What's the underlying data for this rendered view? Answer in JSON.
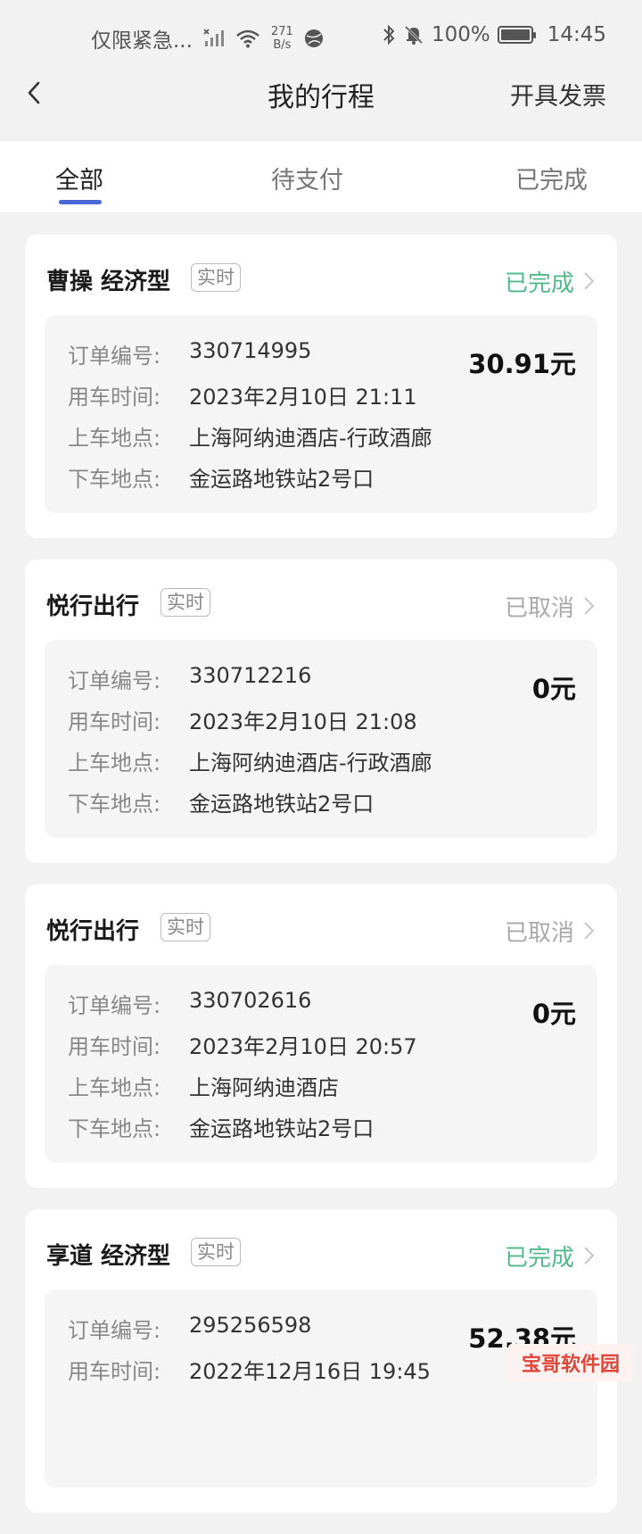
{
  "status_bar": {
    "carrier": "仅限紧急...",
    "net_speed_value": "271",
    "net_speed_unit": "B/s",
    "battery": "100%",
    "time": "14:45",
    "icons": [
      "signal-off-icon",
      "wifi-icon",
      "ball-icon",
      "bluetooth-icon",
      "mute-icon",
      "battery-icon"
    ]
  },
  "header": {
    "title": "我的行程",
    "action": "开具发票"
  },
  "tabs": [
    {
      "label": "全部",
      "active": true
    },
    {
      "label": "待支付",
      "active": false
    },
    {
      "label": "已完成",
      "active": false
    }
  ],
  "labels": {
    "order_no": "订单编号:",
    "time": "用车时间:",
    "pickup": "上车地点:",
    "dropoff": "下车地点:"
  },
  "trips": [
    {
      "provider": "曹操 经济型",
      "tag": "实时",
      "status": "已完成",
      "order_no": "330714995",
      "time": "2023年2月10日 21:11",
      "pickup": "上海阿纳迪酒店-行政酒廊",
      "dropoff": "金运路地铁站2号口",
      "price": "30.91元"
    },
    {
      "provider": "悦行出行",
      "tag": "实时",
      "status": "已取消",
      "order_no": "330712216",
      "time": "2023年2月10日 21:08",
      "pickup": "上海阿纳迪酒店-行政酒廊",
      "dropoff": "金运路地铁站2号口",
      "price": "0元"
    },
    {
      "provider": "悦行出行",
      "tag": "实时",
      "status": "已取消",
      "order_no": "330702616",
      "time": "2023年2月10日 20:57",
      "pickup": "上海阿纳迪酒店",
      "dropoff": "金运路地铁站2号口",
      "price": "0元"
    },
    {
      "provider": "享道 经济型",
      "tag": "实时",
      "status": "已完成",
      "order_no": "295256598",
      "time": "2022年12月16日 19:45",
      "price": "52.38元"
    }
  ],
  "watermark": "宝哥软件园",
  "colors": {
    "accent": "#4a67d6",
    "completed": "#52b98a",
    "cancelled": "#aaaaaa"
  }
}
